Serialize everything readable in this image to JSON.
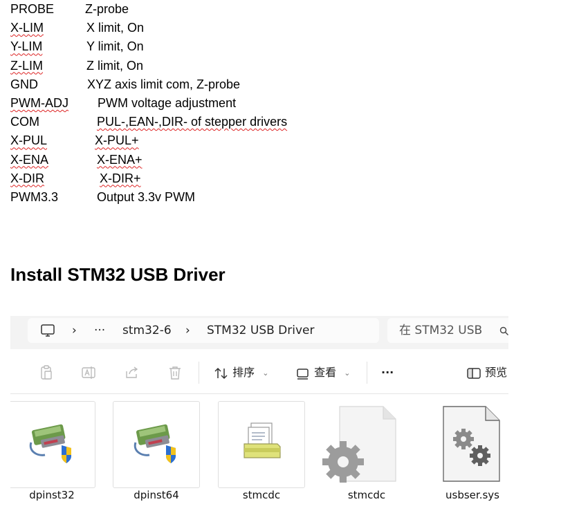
{
  "pins": [
    {
      "name": "PROBE",
      "desc": "Z-probe"
    },
    {
      "name": "X-LIM",
      "desc": "X limit, On"
    },
    {
      "name": "Y-LIM",
      "desc": "Y limit, On"
    },
    {
      "name": "Z-LIM",
      "desc": "Z limit, On"
    },
    {
      "name": "GND",
      "desc": "XYZ axis limit com, Z-probe"
    },
    {
      "name": "PWM-ADJ",
      "desc": "PWM voltage adjustment"
    },
    {
      "name": "COM",
      "desc": "PUL-,EAN-,DIR- of stepper drivers"
    },
    {
      "name": "X-PUL",
      "desc": "X-PUL+"
    },
    {
      "name": "X-ENA",
      "desc": "X-ENA+"
    },
    {
      "name": "X-DIR",
      "desc": "X-DIR+"
    },
    {
      "name": "PWM3.3",
      "desc": "Output 3.3v PWM"
    }
  ],
  "heading": "Install STM32 USB Driver",
  "explorer": {
    "breadcrumb": {
      "more": "···",
      "folder": "stm32-6",
      "current": "STM32 USB Driver",
      "sep": "›"
    },
    "search_placeholder": "在 STM32 USB",
    "toolbar": {
      "sort_label": "排序",
      "view_label": "查看",
      "more": "···",
      "preview_label": "预览"
    },
    "files": [
      {
        "name": "dpinst32",
        "icon": "installer-icon"
      },
      {
        "name": "dpinst64",
        "icon": "installer-icon"
      },
      {
        "name": "stmcdc",
        "icon": "setup-info-icon"
      },
      {
        "name": "stmcdc",
        "icon": "catalog-file-icon"
      },
      {
        "name": "usbser.sys",
        "icon": "system-file-icon"
      }
    ]
  }
}
